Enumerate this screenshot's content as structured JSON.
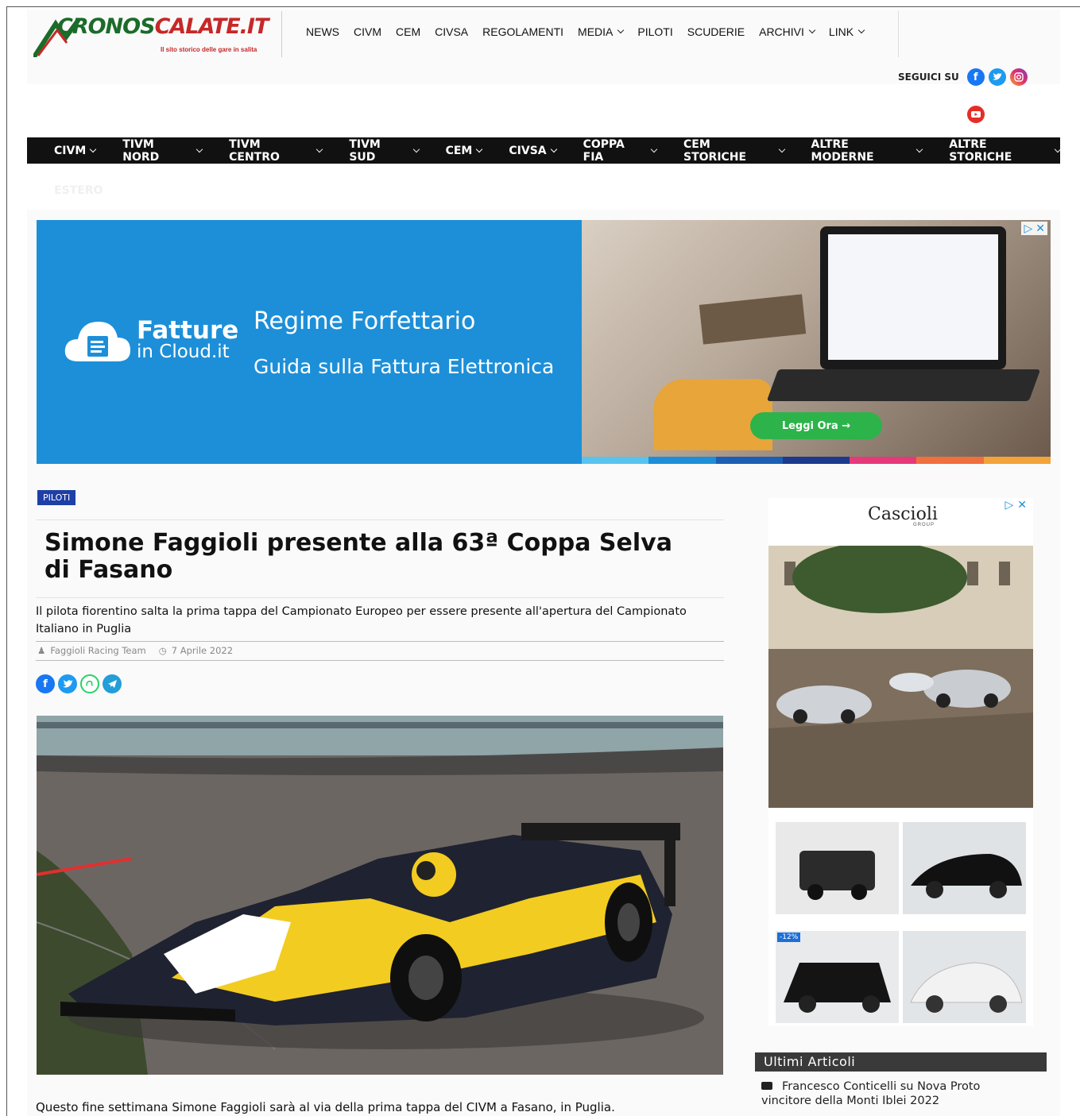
{
  "site": {
    "logo_text_1": "CRONOS",
    "logo_text_2": "CALATE.IT",
    "logo_tagline": "Il sito storico delle gare in salita"
  },
  "top_nav": [
    {
      "label": "NEWS",
      "dropdown": false
    },
    {
      "label": "CIVM",
      "dropdown": false
    },
    {
      "label": "CEM",
      "dropdown": false
    },
    {
      "label": "CIVSA",
      "dropdown": false
    },
    {
      "label": "REGOLAMENTI",
      "dropdown": false
    },
    {
      "label": "MEDIA",
      "dropdown": true
    },
    {
      "label": "PILOTI",
      "dropdown": false
    },
    {
      "label": "SCUDERIE",
      "dropdown": false
    },
    {
      "label": "ARCHIVI",
      "dropdown": true
    },
    {
      "label": "LINK",
      "dropdown": true
    }
  ],
  "follow": {
    "label": "SEGUICI SU",
    "icons": [
      "facebook-icon",
      "twitter-icon",
      "instagram-icon",
      "youtube-icon"
    ]
  },
  "main_nav": [
    "CIVM",
    "TIVM NORD",
    "TIVM CENTRO",
    "TIVM SUD",
    "CEM",
    "CIVSA",
    "COPPA FIA",
    "CEM STORICHE",
    "ALTRE MODERNE",
    "ALTRE STORICHE"
  ],
  "main_nav_overflow": "ESTERO",
  "ad": {
    "brand_line1": "Fatture",
    "brand_line2": "in Cloud.it",
    "title": "Regime Forfettario",
    "subtitle": "Guida sulla Fattura Elettronica",
    "cta": "Leggi Ora →",
    "brand_color": "#1d8fd8",
    "cta_color": "#2cb34a"
  },
  "article": {
    "category": "PILOTI",
    "title": "Simone Faggioli presente alla 63ª Coppa Selva di Fasano",
    "subtitle": "Il pilota fiorentino salta la prima tappa del Campionato Europeo per essere presente all'apertura del Campionato Italiano in Puglia",
    "author": "Faggioli Racing Team",
    "date": "7 Aprile 2022",
    "share_icons": [
      "facebook-icon",
      "twitter-icon",
      "whatsapp-icon",
      "telegram-icon"
    ],
    "body_first_line": "Questo fine settimana Simone Faggioli sarà al via della prima tappa del CIVM a Fasano, in Puglia."
  },
  "sidebar": {
    "ad_brand": "Cascioli",
    "ad_brand_sub": "GROUP",
    "thumb_badge": "-12%",
    "latest_heading": "Ultimi Articoli",
    "latest_items": [
      "Francesco Conticelli su Nova Proto vincitore della Monti Iblei 2022"
    ]
  }
}
